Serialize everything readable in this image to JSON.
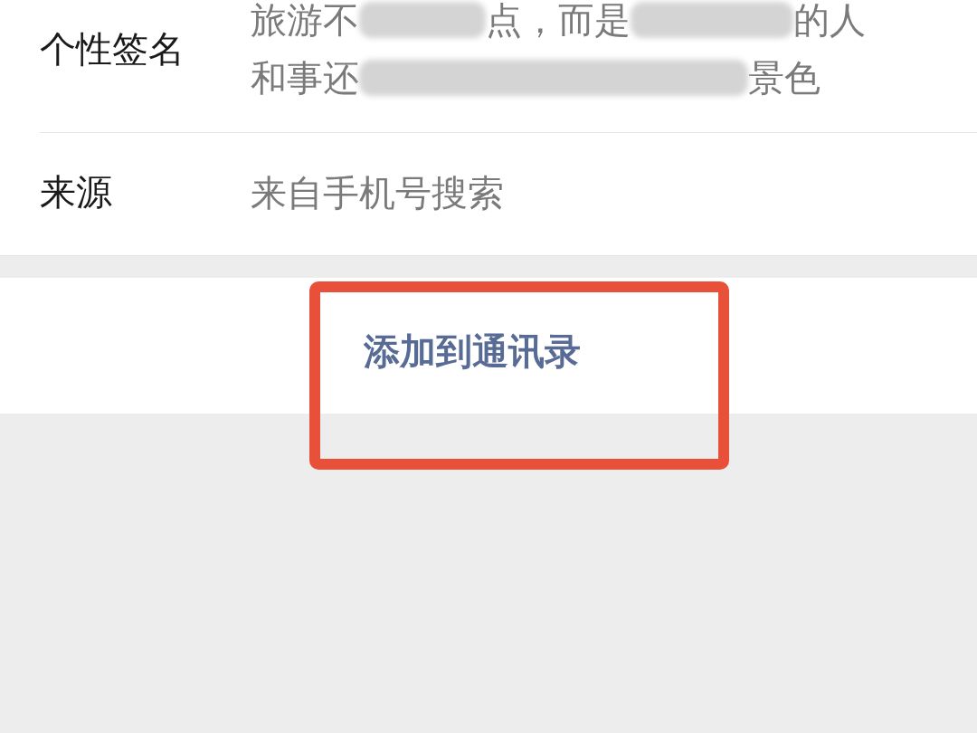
{
  "profile_rows": [
    {
      "label": "个性签名",
      "lines": [
        [
          {
            "kind": "text",
            "text": "旅游不"
          },
          {
            "kind": "blur"
          },
          {
            "kind": "text",
            "text": "点，而是"
          },
          {
            "kind": "blur"
          },
          {
            "kind": "text",
            "text": "的人"
          }
        ],
        [
          {
            "kind": "text",
            "text": "和事还"
          },
          {
            "kind": "blur"
          },
          {
            "kind": "text",
            "text": "景色"
          }
        ]
      ]
    },
    {
      "label": "来源",
      "lines": [
        [
          {
            "kind": "text",
            "text": "来自手机号搜索"
          }
        ]
      ]
    }
  ],
  "action_button": {
    "label": "添加到通讯录",
    "highlighted": true
  }
}
